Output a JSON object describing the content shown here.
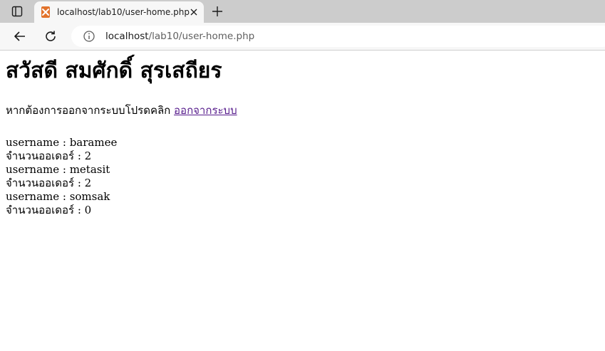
{
  "browser": {
    "tab": {
      "title": "localhost/lab10/user-home.php"
    },
    "address": {
      "host": "localhost",
      "path": "/lab10/user-home.php"
    }
  },
  "page": {
    "heading": "สวัสดี สมศักดิ์ สุรเสถียร",
    "logout_text": "หากต้องการออกจากระบบโปรดคลิก",
    "logout_link": "ออกจากระบบ",
    "users": [
      {
        "username_line": "username : baramee",
        "orders_line": "จำนวนออเดอร์ : 2"
      },
      {
        "username_line": "username : metasit",
        "orders_line": "จำนวนออเดอร์ : 2"
      },
      {
        "username_line": "username : somsak",
        "orders_line": "จำนวนออเดอร์ : 0"
      }
    ]
  }
}
